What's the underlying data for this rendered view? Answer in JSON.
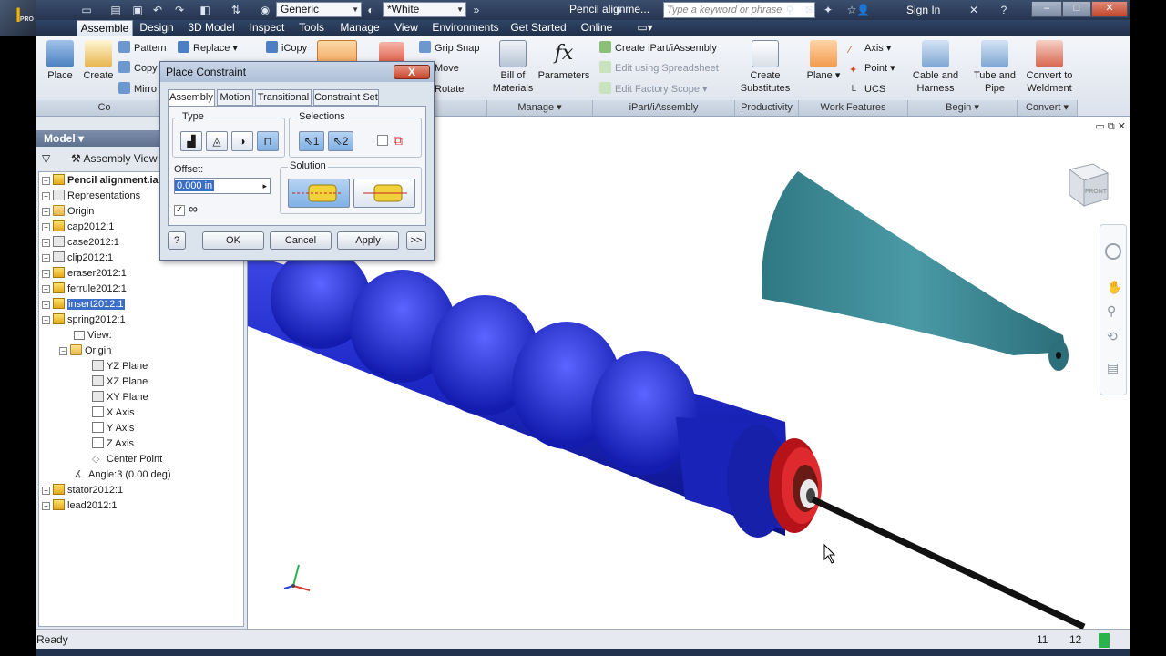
{
  "app": {
    "logo": "I",
    "logo_sub": "PRO",
    "title": "Pencil alignme...",
    "search_placeholder": "Type a keyword or phrase",
    "sign_in": "Sign In",
    "material": "Generic",
    "appearance": "*White"
  },
  "tabs": [
    "Assemble",
    "Design",
    "3D Model",
    "Inspect",
    "Tools",
    "Manage",
    "View",
    "Environments",
    "Get Started",
    "Online"
  ],
  "ribbon": {
    "place": "Place",
    "create": "Create",
    "pattern": "Pattern",
    "copy": "Copy",
    "mirror": "Mirro",
    "replace": "Replace",
    "icopy": "iCopy",
    "grip_snap": "Grip Snap",
    "move": "Move",
    "rotate": "Rotate",
    "bill": "Bill of Materials",
    "parameters": "Parameters",
    "create_ipart": "Create iPart/iAssembly",
    "edit_spreadsheet": "Edit using Spreadsheet",
    "edit_factory": "Edit Factory Scope",
    "create_substitutes": "Create Substitutes",
    "plane": "Plane",
    "axis": "Axis",
    "point": "Point",
    "ucs": "UCS",
    "cable": "Cable and Harness",
    "tube": "Tube and Pipe",
    "convert_weldment": "Convert to Weldment",
    "panels": {
      "component": "Co",
      "manage": "Manage",
      "ipart": "iPart/iAssembly",
      "productivity": "Productivity",
      "work": "Work Features",
      "begin": "Begin",
      "convert": "Convert"
    }
  },
  "browser": {
    "header": "Model",
    "view": "Assembly View",
    "root": "Pencil alignment.iam",
    "nodes": {
      "representations": "Representations",
      "origin": "Origin",
      "cap": "cap2012:1",
      "case": "case2012:1",
      "clip": "clip2012:1",
      "eraser": "eraser2012:1",
      "ferrule": "ferrule2012:1",
      "insert": "insert2012:1",
      "spring": "spring2012:1",
      "view": "View:",
      "origin2": "Origin",
      "yz": "YZ Plane",
      "xz": "XZ Plane",
      "xy": "XY Plane",
      "xaxis": "X Axis",
      "yaxis": "Y Axis",
      "zaxis": "Z Axis",
      "center": "Center Point",
      "angle": "Angle:3 (0.00 deg)",
      "stator": "stator2012:1",
      "lead": "lead2012:1"
    }
  },
  "dialog": {
    "title": "Place Constraint",
    "close": "X",
    "tabs": [
      "Assembly",
      "Motion",
      "Transitional",
      "Constraint Set"
    ],
    "type_label": "Type",
    "selections_label": "Selections",
    "sel1": "1",
    "sel2": "2",
    "offset_label": "Offset:",
    "offset_value": "0.000 in",
    "solution_label": "Solution",
    "ok": "OK",
    "cancel": "Cancel",
    "apply": "Apply",
    "more": ">>",
    "help": "?"
  },
  "viewcube": {
    "face": "FRONT"
  },
  "status": {
    "text": "Ready",
    "count1": "11",
    "count2": "12"
  },
  "colors": {
    "body_blue": "#1d27c4",
    "cap_teal": "#3b8b97",
    "ferrule_red": "#c8161a",
    "lead_black": "#111111"
  }
}
